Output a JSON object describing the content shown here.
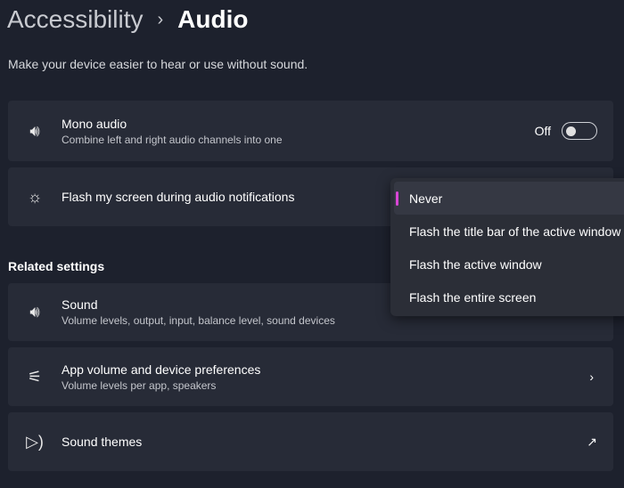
{
  "breadcrumb": {
    "parent": "Accessibility",
    "current": "Audio"
  },
  "subtitle": "Make your device easier to hear or use without sound.",
  "mono": {
    "title": "Mono audio",
    "desc": "Combine left and right audio channels into one",
    "state": "Off"
  },
  "flash": {
    "title": "Flash my screen during audio notifications"
  },
  "related_header": "Related settings",
  "related": [
    {
      "title": "Sound",
      "desc": "Volume levels, output, input, balance level, sound devices"
    },
    {
      "title": "App volume and device preferences",
      "desc": "Volume levels per app, speakers"
    },
    {
      "title": "Sound themes"
    }
  ],
  "dropdown": {
    "options": [
      "Never",
      "Flash the title bar of the active window",
      "Flash the active window",
      "Flash the entire screen"
    ],
    "selected": "Never"
  },
  "accent": "#d946d6"
}
